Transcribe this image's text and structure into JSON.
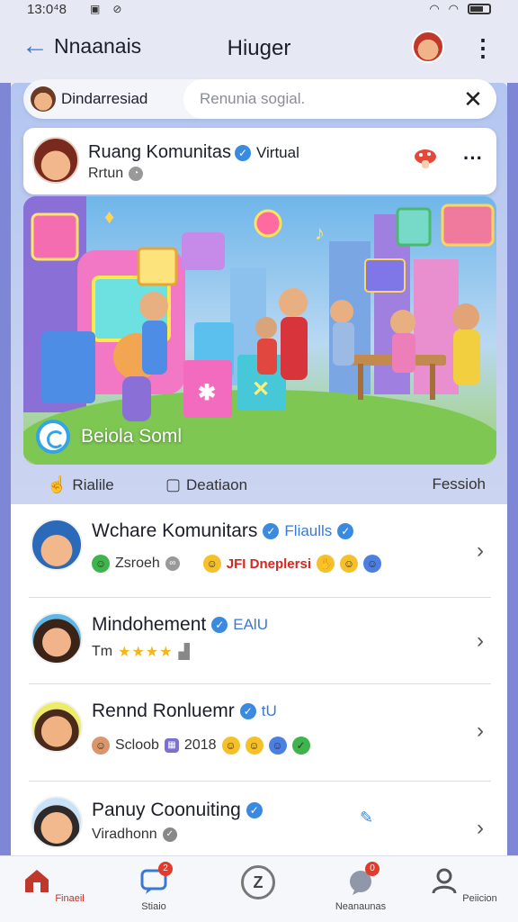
{
  "status_bar": {
    "time": "13:0⁴8"
  },
  "app_bar": {
    "back_label": "Nnaanais",
    "title": "Hiuger"
  },
  "search": {
    "chip_label": "Dindarresiad",
    "placeholder": "Renunia sogial.",
    "close": "✕"
  },
  "community": {
    "title": "Ruang Komunitas",
    "tag": "Virtual",
    "subtitle": "Rrtun",
    "more": "···"
  },
  "banner": {
    "caption": "Beiola Soml"
  },
  "actions": {
    "like": "Rialile",
    "comment": "Deatiaon",
    "share": "Fessioh"
  },
  "list": [
    {
      "title": "Wchare Komunitars",
      "tag": "Fliaulls",
      "meta_label": "Zsroeh",
      "reactions": "JFI Dneplersi",
      "avatar_color": "#f0c6e3"
    },
    {
      "title": "Mindohement",
      "tag": "EAlU",
      "meta_label": "Tm",
      "stars": "★★★★",
      "avatar_color": "#5fb7e6"
    },
    {
      "title": "Rennd Ronluemr",
      "tag": "tU",
      "meta_label": "Scloob",
      "meta_label_2": "2018",
      "avatar_color": "#ecec6a"
    },
    {
      "title": "Panuy Coonuiting",
      "tag": "",
      "meta_label": "Viradhonn",
      "avatar_color": "#c9e2f7"
    }
  ],
  "bottom_nav": [
    {
      "label": "Finaeil",
      "icon": "home-icon",
      "active": true
    },
    {
      "label": "Stiaio",
      "icon": "chat-icon",
      "badge": "2",
      "active": false
    },
    {
      "label": "",
      "icon": "z-icon",
      "active": false
    },
    {
      "label": "Neanaunas",
      "icon": "notification-icon",
      "badge": "0",
      "active": false
    },
    {
      "label": "Peiicion",
      "icon": "profile-icon",
      "active": false
    }
  ],
  "colors": {
    "accent": "#3a78d8",
    "verified": "#3a8ae0",
    "badge": "#e23a2b"
  }
}
